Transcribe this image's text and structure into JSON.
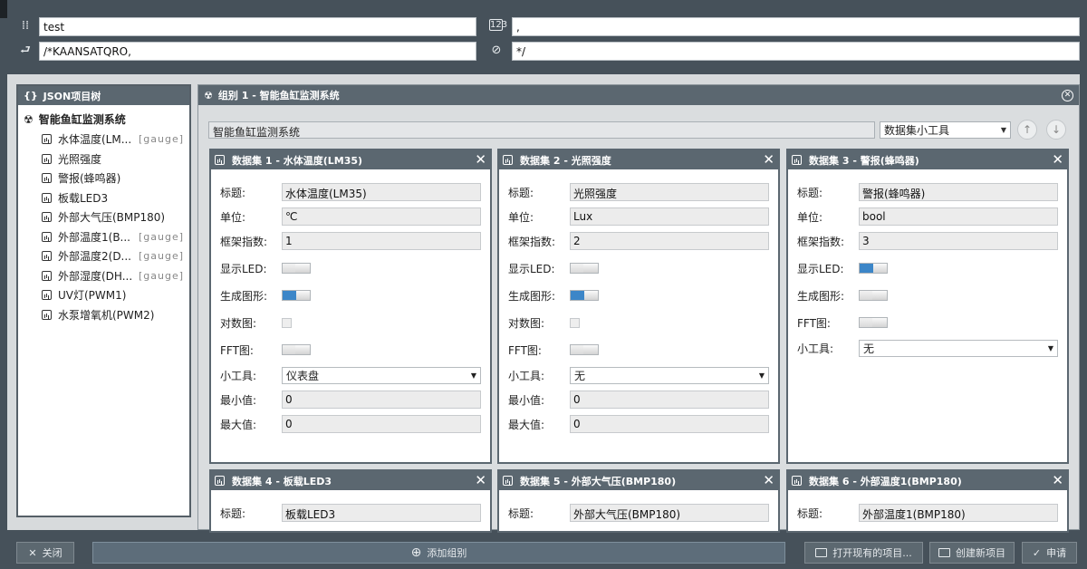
{
  "top": {
    "title_value": "test",
    "separator_value": ",",
    "frame_start_value": "/*KAANSATQRO,",
    "frame_end_value": "*/"
  },
  "tree": {
    "header": "JSON项目树",
    "root": "智能鱼缸监测系统",
    "items": [
      {
        "label": "水体温度(LM...",
        "tag": "[gauge]"
      },
      {
        "label": "光照强度",
        "tag": ""
      },
      {
        "label": "警报(蜂鸣器)",
        "tag": ""
      },
      {
        "label": "板载LED3",
        "tag": ""
      },
      {
        "label": "外部大气压(BMP180)",
        "tag": ""
      },
      {
        "label": "外部温度1(B...",
        "tag": "[gauge]"
      },
      {
        "label": "外部温度2(D...",
        "tag": "[gauge]"
      },
      {
        "label": "外部湿度(DH...",
        "tag": "[gauge]"
      },
      {
        "label": "UV灯(PWM1)",
        "tag": ""
      },
      {
        "label": "水泵增氧机(PWM2)",
        "tag": ""
      }
    ]
  },
  "group": {
    "header": "组别 1 - 智能鱼缸监测系统",
    "title_value": "智能鱼缸监测系统",
    "widget_select": "数据集小工具",
    "labels": {
      "title": "标题:",
      "unit": "单位:",
      "index": "框架指数:",
      "led": "显示LED:",
      "graph": "生成图形:",
      "log": "对数图:",
      "fft": "FFT图:",
      "widget": "小工具:",
      "min": "最小值:",
      "max": "最大值:"
    },
    "datasets": [
      {
        "header": "数据集 1 - 水体温度(LM35)",
        "title": "水体温度(LM35)",
        "unit": "℃",
        "index": "1",
        "widget": "仪表盘",
        "min": "0",
        "max": "0"
      },
      {
        "header": "数据集 2 - 光照强度",
        "title": "光照强度",
        "unit": "Lux",
        "index": "2",
        "widget": "无",
        "min": "0",
        "max": "0"
      },
      {
        "header": "数据集 3 - 警报(蜂鸣器)",
        "title": "警报(蜂鸣器)",
        "unit": "bool",
        "index": "3",
        "widget": "无"
      },
      {
        "header": "数据集 4 - 板载LED3",
        "title": "板载LED3"
      },
      {
        "header": "数据集 5 - 外部大气压(BMP180)",
        "title": "外部大气压(BMP180)"
      },
      {
        "header": "数据集 6 - 外部温度1(BMP180)",
        "title": "外部温度1(BMP180)"
      }
    ]
  },
  "bottom": {
    "close": "关闭",
    "add_group": "添加组别",
    "open": "打开现有的项目...",
    "create": "创建新项目",
    "apply": "申请"
  }
}
